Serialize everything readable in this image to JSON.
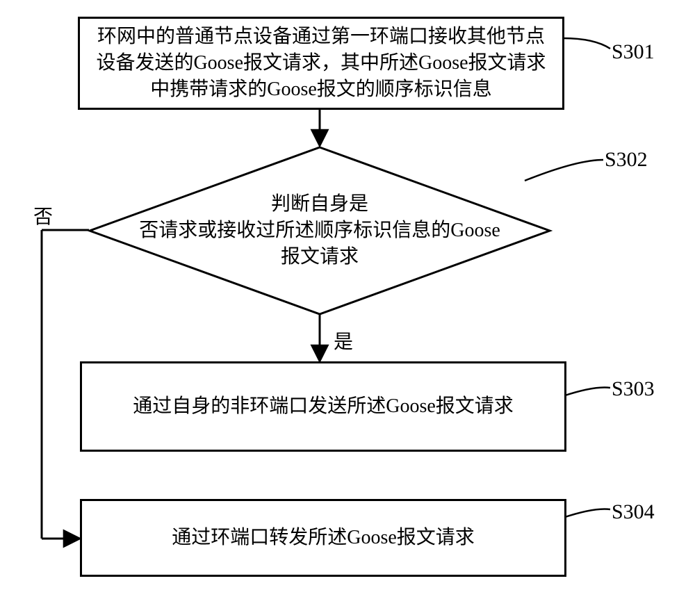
{
  "nodes": {
    "s301": {
      "id": "S301",
      "text": "环网中的普通节点设备通过第一环端口接收其他节点设备发送的Goose报文请求，其中所述Goose报文请求中携带请求的Goose报文的顺序标识信息"
    },
    "s302": {
      "id": "S302",
      "text_line1": "判断自身是",
      "text_line2": "否请求或接收过所述顺序标识信息的Goose",
      "text_line3": "报文请求"
    },
    "s303": {
      "id": "S303",
      "text": "通过自身的非环端口发送所述Goose报文请求"
    },
    "s304": {
      "id": "S304",
      "text": "通过环端口转发所述Goose报文请求"
    }
  },
  "edges": {
    "yes_label": "是",
    "no_label": "否"
  }
}
